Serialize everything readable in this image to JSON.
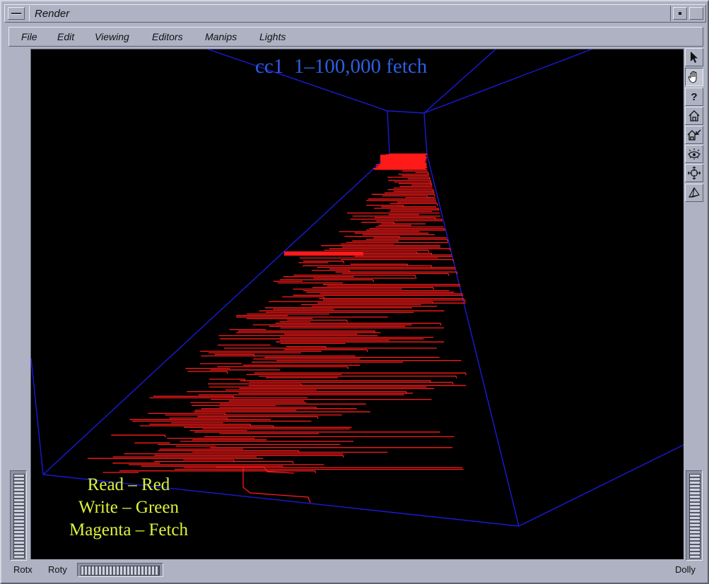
{
  "window": {
    "title": "Render"
  },
  "menubar": {
    "items": [
      "File",
      "Edit",
      "Viewing",
      "Editors",
      "Manips",
      "Lights"
    ]
  },
  "viewport": {
    "title": "cc1  1–100,000 fetch",
    "title_color": "#2c5fe0",
    "frame_color": "#1a1ad8",
    "trace_color": "#ff1a1a",
    "legend": [
      "Read – Red",
      "Write – Green",
      "Magenta – Fetch"
    ],
    "legend_color": "#ddf23c"
  },
  "toolbar": {
    "tools": [
      "pick-arrow-icon",
      "hand-icon",
      "help-icon",
      "home-icon",
      "set-home-icon",
      "view-all-icon",
      "seek-icon",
      "projection-icon"
    ],
    "active_tool": "hand-icon",
    "help_glyph": "?"
  },
  "bottom": {
    "rotx": "Rotx",
    "roty": "Roty",
    "dolly": "Dolly"
  }
}
